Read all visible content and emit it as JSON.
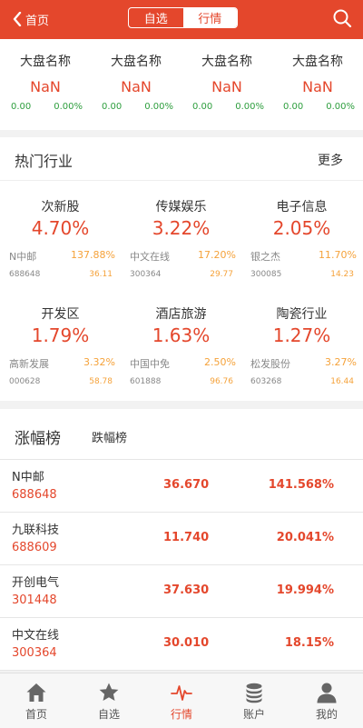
{
  "header": {
    "back_label": "首页",
    "segments": [
      "自选",
      "行情"
    ],
    "active_segment": "行情"
  },
  "indices": [
    {
      "name": "大盘名称",
      "value": "NaN",
      "change": "0.00",
      "percent": "0.00%"
    },
    {
      "name": "大盘名称",
      "value": "NaN",
      "change": "0.00",
      "percent": "0.00%"
    },
    {
      "name": "大盘名称",
      "value": "NaN",
      "change": "0.00",
      "percent": "0.00%"
    },
    {
      "name": "大盘名称",
      "value": "NaN",
      "change": "0.00",
      "percent": "0.00%"
    }
  ],
  "hot": {
    "title": "热门行业",
    "more_label": "更多",
    "items": [
      {
        "name": "次新股",
        "percent": "4.70%",
        "stock": "N中邮",
        "stock_change": "137.88%",
        "code": "688648",
        "price": "36.11"
      },
      {
        "name": "传媒娱乐",
        "percent": "3.22%",
        "stock": "中文在线",
        "stock_change": "17.20%",
        "code": "300364",
        "price": "29.77"
      },
      {
        "name": "电子信息",
        "percent": "2.05%",
        "stock": "银之杰",
        "stock_change": "11.70%",
        "code": "300085",
        "price": "14.23"
      },
      {
        "name": "开发区",
        "percent": "1.79%",
        "stock": "高新发展",
        "stock_change": "3.32%",
        "code": "000628",
        "price": "58.78"
      },
      {
        "name": "酒店旅游",
        "percent": "1.63%",
        "stock": "中国中免",
        "stock_change": "2.50%",
        "code": "601888",
        "price": "96.76"
      },
      {
        "name": "陶瓷行业",
        "percent": "1.27%",
        "stock": "松发股份",
        "stock_change": "3.27%",
        "code": "603268",
        "price": "16.44"
      }
    ]
  },
  "ranking": {
    "tabs": [
      "涨幅榜",
      "跌幅榜"
    ],
    "active_tab": "涨幅榜",
    "rows": [
      {
        "name": "N中邮",
        "code": "688648",
        "price": "36.670",
        "change": "141.568%"
      },
      {
        "name": "九联科技",
        "code": "688609",
        "price": "11.740",
        "change": "20.041%"
      },
      {
        "name": "开创电气",
        "code": "301448",
        "price": "37.630",
        "change": "19.994%"
      },
      {
        "name": "中文在线",
        "code": "300364",
        "price": "30.010",
        "change": "18.15%"
      }
    ]
  },
  "tabbar": {
    "items": [
      {
        "label": "首页",
        "icon": "home-icon"
      },
      {
        "label": "自选",
        "icon": "star-icon"
      },
      {
        "label": "行情",
        "icon": "pulse-icon"
      },
      {
        "label": "账户",
        "icon": "coins-icon"
      },
      {
        "label": "我的",
        "icon": "user-icon"
      }
    ],
    "active": "行情"
  },
  "colors": {
    "brand": "#e4472c",
    "up": "#e4472c",
    "down": "#2e9e3e",
    "stock_change": "#f5a23a"
  }
}
